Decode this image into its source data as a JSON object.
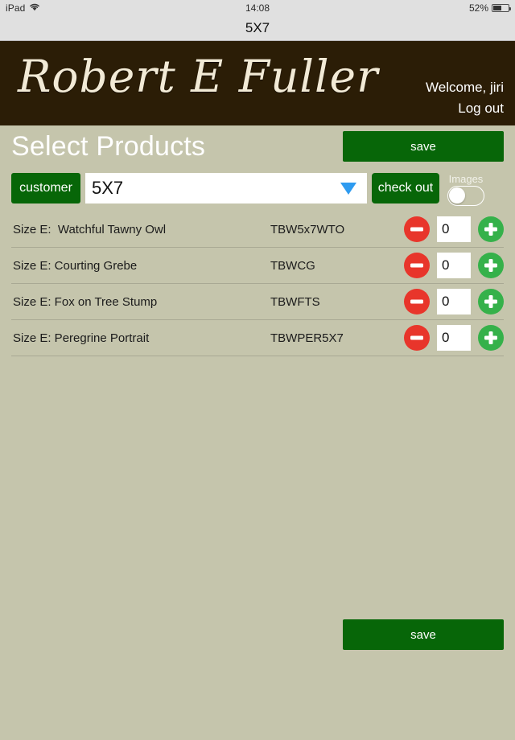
{
  "status_bar": {
    "device": "iPad",
    "wifi_icon": "wifi-icon",
    "time": "14:08",
    "battery_percent": "52%",
    "battery_level": 52
  },
  "nav_bar": {
    "title": "5X7"
  },
  "brand_header": {
    "logo_text": "Robert E Fuller",
    "welcome": "Welcome, jiri",
    "logout": "Log out",
    "background": "#2b1d06",
    "logo_color": "#f2ead6"
  },
  "page": {
    "title": "Select Products",
    "background": "#c5c5ac",
    "accent_green": "#076608",
    "minus_red": "#e8352b",
    "plus_green": "#35b14a",
    "arrow_blue": "#2e9bf0"
  },
  "toolbar": {
    "save_top_label": "save",
    "save_bottom_label": "save",
    "customer_label": "customer",
    "checkout_label": "check out",
    "size_select_value": "5X7",
    "size_select_arrow_icon": "chevron-down-icon",
    "images_toggle_label": "Images",
    "images_toggle_state": "off"
  },
  "products": [
    {
      "name": "Size E:  Watchful Tawny Owl",
      "sku": "TBW5x7WTO",
      "quantity": "0",
      "decrement_icon": "minus-circle-icon",
      "increment_icon": "plus-circle-icon"
    },
    {
      "name": "Size E: Courting Grebe",
      "sku": "TBWCG",
      "quantity": "0",
      "decrement_icon": "minus-circle-icon",
      "increment_icon": "plus-circle-icon"
    },
    {
      "name": "Size E: Fox on Tree Stump",
      "sku": "TBWFTS",
      "quantity": "0",
      "decrement_icon": "minus-circle-icon",
      "increment_icon": "plus-circle-icon"
    },
    {
      "name": "Size E: Peregrine Portrait",
      "sku": "TBWPER5X7",
      "quantity": "0",
      "decrement_icon": "minus-circle-icon",
      "increment_icon": "plus-circle-icon"
    }
  ]
}
